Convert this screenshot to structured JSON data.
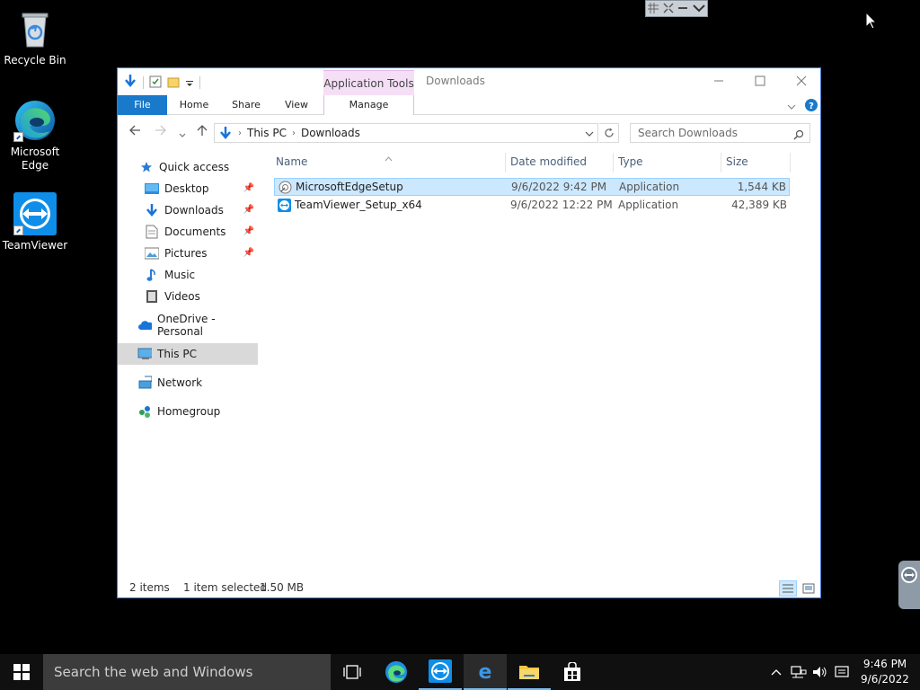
{
  "desktop": {
    "icons": [
      {
        "label": "Recycle Bin"
      },
      {
        "label": "Microsoft\nEdge"
      },
      {
        "label": "TeamViewer"
      }
    ]
  },
  "window": {
    "app_tools": "Application Tools",
    "title": "Downloads",
    "ribbon_tabs": {
      "file": "File",
      "home": "Home",
      "share": "Share",
      "view": "View",
      "manage": "Manage"
    },
    "breadcrumb": [
      "This PC",
      "Downloads"
    ],
    "search_placeholder": "Search Downloads",
    "nav": {
      "quick_access": "Quick access",
      "desktop": "Desktop",
      "downloads": "Downloads",
      "documents": "Documents",
      "pictures": "Pictures",
      "music": "Music",
      "videos": "Videos",
      "onedrive": "OneDrive - Personal",
      "this_pc": "This PC",
      "network": "Network",
      "homegroup": "Homegroup"
    },
    "columns": {
      "name": "Name",
      "date": "Date modified",
      "type": "Type",
      "size": "Size"
    },
    "files": [
      {
        "name": "MicrosoftEdgeSetup",
        "date": "9/6/2022 9:42 PM",
        "type": "Application",
        "size": "1,544 KB",
        "selected": true
      },
      {
        "name": "TeamViewer_Setup_x64",
        "date": "9/6/2022 12:22 PM",
        "type": "Application",
        "size": "42,389 KB",
        "selected": false
      }
    ],
    "status": {
      "count": "2 items",
      "selected": "1 item selected",
      "size": "1.50 MB"
    }
  },
  "taskbar": {
    "search_placeholder": "Search the web and Windows",
    "time": "9:46 PM",
    "date": "9/6/2022"
  },
  "colors": {
    "accent": "#1979ca",
    "selection": "#cce8ff",
    "app_tools": "#f5dff6"
  }
}
